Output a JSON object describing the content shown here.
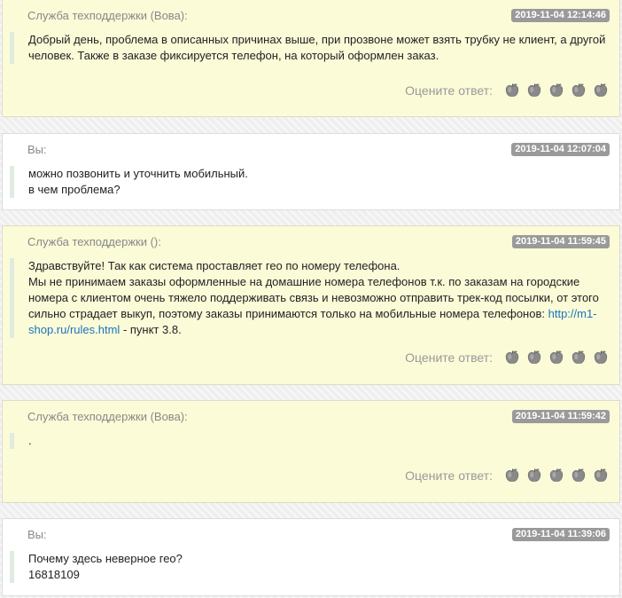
{
  "rating_label": "Оцените ответ:",
  "messages": [
    {
      "author": "Служба техподдержки (Вова):",
      "time": "2019-11-04 12:14:46",
      "lines": [
        "Добрый день, проблема в описанных причинах выше, при прозвоне может взять трубку не клиент, а другой человек. Также в заказе фиксируется телефон, на который оформлен заказ."
      ]
    },
    {
      "author": "Вы:",
      "time": "2019-11-04 12:07:04",
      "lines": [
        "можно позвонить и уточнить мобильный.",
        "в чем проблема?"
      ]
    },
    {
      "author": "Служба техподдержки ():",
      "time": "2019-11-04 11:59:45",
      "lines": [
        "Здравствуйте! Так как система проставляет гео по номеру телефона."
      ],
      "text_before_link": "Мы не принимаем заказы оформленные на домашние номера телефонов т.к. по заказам на городские номера с клиентом очень тяжело поддерживать связь и невозможно отправить трек-код посылки, от этого сильно страдает выкуп, поэтому заказы принимаются только на мобильные номера телефонов: ",
      "link": "http://m1-shop.ru/rules.html",
      "text_after_link": " - пункт 3.8."
    },
    {
      "author": "Служба техподдержки (Вова):",
      "time": "2019-11-04 11:59:42",
      "lines": [
        "."
      ]
    },
    {
      "author": "Вы:",
      "time": "2019-11-04 11:39:06",
      "lines": [
        "Почему здесь неверное гео?",
        "16818109"
      ]
    }
  ],
  "icons": {
    "rating": [
      "apple-rating-1-icon",
      "apple-rating-2-icon",
      "apple-rating-3-icon",
      "apple-rating-4-icon",
      "apple-rating-5-icon"
    ]
  }
}
